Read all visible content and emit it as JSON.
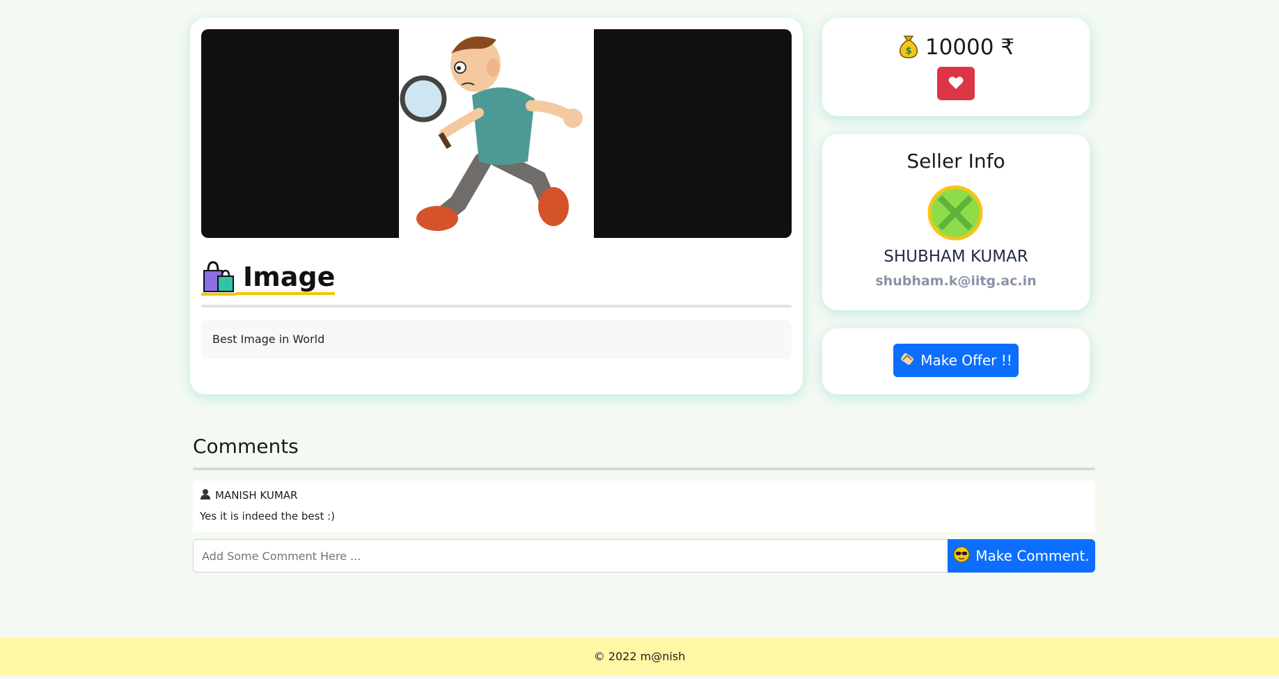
{
  "product": {
    "title": "Image",
    "description": "Best Image in World",
    "image_icon": "cartoon-detective-with-magnifier",
    "title_icon": "shopping-bags-icon"
  },
  "price": {
    "icon": "money-bag-icon",
    "value": "10000 ₹"
  },
  "like": {
    "icon": "heart-icon",
    "color": "#dc3545"
  },
  "seller": {
    "heading": "Seller Info",
    "name": "SHUBHAM KUMAR",
    "email": "shubham.k@iitg.ac.in",
    "avatar_icon": "green-x-avatar"
  },
  "offer": {
    "label": "Make Offer !!",
    "icon": "handshake-icon"
  },
  "comments": {
    "heading": "Comments",
    "items": [
      {
        "author": "MANISH KUMAR",
        "text": "Yes it is indeed the best :)"
      }
    ],
    "input_placeholder": "Add Some Comment Here ...",
    "submit_label": "Make Comment.",
    "submit_icon": "sunglasses-face-icon"
  },
  "footer": {
    "text": "© 2022 m@nish"
  },
  "colors": {
    "primary": "#0d6efd",
    "danger": "#dc3545",
    "accent_underline": "#f2c500",
    "footer_bg": "#fef7a5"
  }
}
